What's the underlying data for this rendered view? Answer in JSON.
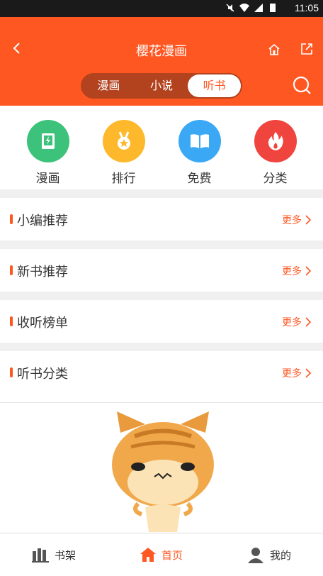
{
  "status_bar": {
    "time": "11:05"
  },
  "header": {
    "title": "樱花漫画",
    "tabs": [
      {
        "label": "漫画",
        "active": false
      },
      {
        "label": "小说",
        "active": false
      },
      {
        "label": "听书",
        "active": true
      }
    ]
  },
  "categories": [
    {
      "label": "漫画",
      "icon": "comic-book-icon",
      "color": "#3cc27a"
    },
    {
      "label": "排行",
      "icon": "medal-icon",
      "color": "#fdb92b"
    },
    {
      "label": "免费",
      "icon": "open-book-icon",
      "color": "#3ba8f5"
    },
    {
      "label": "分类",
      "icon": "flame-icon",
      "color": "#f0443e"
    }
  ],
  "sections": [
    {
      "title": "小编推荐",
      "more": "更多"
    },
    {
      "title": "新书推荐",
      "more": "更多"
    },
    {
      "title": "收听榜单",
      "more": "更多"
    },
    {
      "title": "听书分类",
      "more": "更多"
    }
  ],
  "bottom_nav": [
    {
      "label": "书架",
      "icon": "bookshelf-icon",
      "active": false
    },
    {
      "label": "首页",
      "icon": "home-icon",
      "active": true
    },
    {
      "label": "我的",
      "icon": "user-icon",
      "active": false
    }
  ],
  "colors": {
    "accent": "#ff5722",
    "tab_track": "#b3421e"
  }
}
